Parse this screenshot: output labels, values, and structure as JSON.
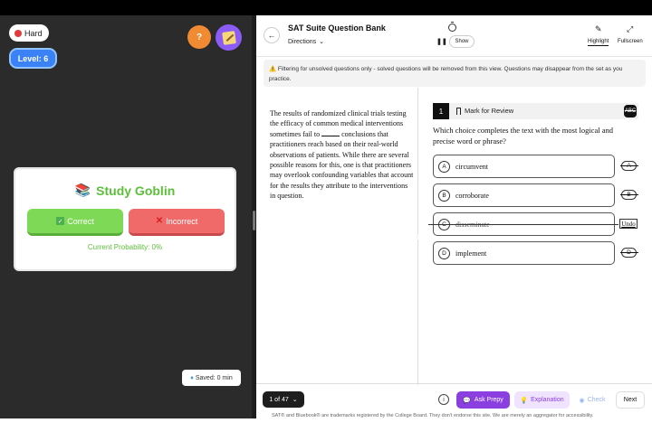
{
  "left_panel": {
    "difficulty": "Hard",
    "level": "Level: 6",
    "help_icon": "?",
    "card": {
      "title": "Study Goblin",
      "correct_label": "Correct",
      "incorrect_label": "Incorrect",
      "probability": "Current Probability: 0%"
    },
    "saved": "Saved: 0 min"
  },
  "header": {
    "title": "SAT Suite Question Bank",
    "directions": "Directions",
    "timer_toggle": "Show",
    "highlight": "Highlight",
    "fullscreen": "Fullscreen"
  },
  "banner": "Filtering for unsolved questions only - solved questions will be removed from this view. Questions may disappear from the set as you practice.",
  "passage": {
    "before": "The results of randomized clinical trials testing the efficacy of common medical interventions sometimes fail to",
    "after": "conclusions that practitioners reach based on their real-world observations of patients. While there are several possible reasons for this, one is that practitioners may overlook confounding variables that account for the results they attribute to the interventions in question."
  },
  "question": {
    "number": "1",
    "mark_label": "Mark for Review",
    "abc_label": "ABC",
    "prompt": "Which choice completes the text with the most logical and precise word or phrase?",
    "options": [
      {
        "letter": "A",
        "text": "circumvent"
      },
      {
        "letter": "B",
        "text": "corroborate"
      },
      {
        "letter": "C",
        "text": "disseminate"
      },
      {
        "letter": "D",
        "text": "implement"
      }
    ],
    "undo_label": "Undo"
  },
  "footer": {
    "counter": "1 of 47",
    "ask": "Ask Prepy",
    "explanation": "Explanation",
    "check": "Check",
    "next": "Next",
    "disclaimer": "SAT® and Bluebook® are trademarks registered by the College Board. They don't endorse this site. We are merely an aggregator for accessibility."
  },
  "colors": {
    "accent_purple": "#8b3fe0",
    "level_blue": "#3b82f6",
    "correct_green": "#7ed957",
    "incorrect_red": "#f06a6a"
  }
}
